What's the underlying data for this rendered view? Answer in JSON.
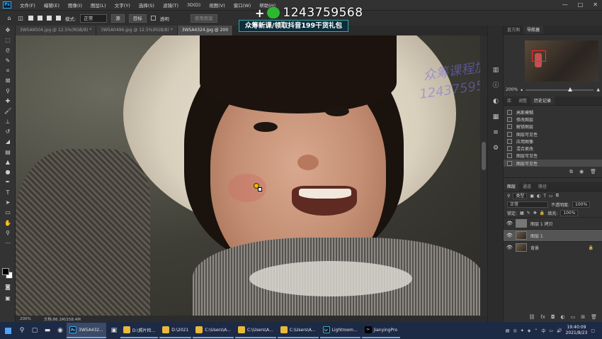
{
  "menu": {
    "items": [
      "文件(F)",
      "编辑(E)",
      "图像(I)",
      "图层(L)",
      "文字(Y)",
      "选择(S)",
      "滤镜(T)",
      "3D(D)",
      "视图(V)",
      "窗口(W)",
      "帮助(H)"
    ],
    "window_controls": [
      "—",
      "□",
      "✕"
    ]
  },
  "options": {
    "mode_label": "模式:",
    "mode_value": "正常",
    "btn_source": "源",
    "btn_target": "目标",
    "transparent_label": "透明",
    "use_pattern": "使用图案"
  },
  "watermark": {
    "number": "1243759568",
    "banner": "众筹新课/领取抖音199干货礼包",
    "faint_line1": "众筹课程加V:",
    "faint_line2": "1243759568"
  },
  "doc_tabs": [
    "3W5A9504.jpg @ 12.5%(RGB/8) *",
    "3W5A0496.jpg @ 12.5%(RGB/8) *",
    "3W5A4324.jpg @ 200"
  ],
  "status": {
    "zoom": "200%",
    "doc": "文档:86.1M/258.4M"
  },
  "panels": {
    "nav_tabs": [
      "直方图",
      "导航器"
    ],
    "nav_zoom": "200%",
    "hist_tabs": [
      "库",
      "调整",
      "历史记录"
    ],
    "history": [
      "高斯模糊",
      "修改图层",
      "解锁图层",
      "图层可见性",
      "应用图像",
      "混合更改",
      "图层可见性",
      "图层可见性"
    ],
    "layers_tabs": [
      "图层",
      "通道",
      "路径"
    ],
    "kind_label": "类型",
    "blend_mode": "正常",
    "opacity_label": "不透明度:",
    "opacity_value": "100%",
    "lock_label": "锁定:",
    "fill_label": "填充:",
    "fill_value": "100%",
    "layers": [
      "图层 1 拷贝",
      "图层 1",
      "背景"
    ]
  },
  "taskbar": {
    "apps": [
      "3W5A432...",
      "D:\\照片检...",
      "D:\\2021",
      "C:\\Users\\A...",
      "C:\\Users\\A...",
      "C:\\Users\\A...",
      "Lightroom...",
      "JianyingPro"
    ],
    "time": "19:40:09",
    "date": "2021/8/23",
    "ime": "中"
  },
  "colors": {
    "accent": "#31a8ff",
    "taskbar": "#1c2a45",
    "nav_box": "#ff2a2a"
  }
}
